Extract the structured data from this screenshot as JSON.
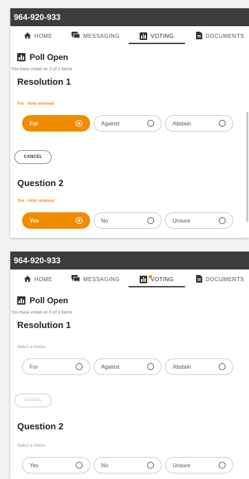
{
  "panels": [
    {
      "title": "964-920-933",
      "tabs": {
        "home": "HOME",
        "messaging": "MESSAGING",
        "voting": "VOTING",
        "documents": "DOCUMENTS"
      },
      "poll_header": "Poll Open",
      "voted_text": "You have voted on 2 of 2 items",
      "resolution": {
        "title": "Resolution 1",
        "status": "For - Vote received",
        "options": [
          "For",
          "Against",
          "Abstain"
        ],
        "selected": "For"
      },
      "cancel_label": "CANCEL",
      "question": {
        "title": "Question 2",
        "status": "Yes - Vote received",
        "options": [
          "Yes",
          "No",
          "Unsure"
        ],
        "selected": "Yes"
      }
    },
    {
      "title": "964-920-933",
      "tabs": {
        "home": "HOME",
        "messaging": "MESSAGING",
        "voting": "VOTING",
        "documents": "DOCUMENTS"
      },
      "poll_header": "Poll Open",
      "voted_text": "You have voted on 0 of 2 items",
      "resolution": {
        "title": "Resolution 1",
        "status": "Select a choice.",
        "options": [
          "For",
          "Against",
          "Abstain"
        ],
        "selected": ""
      },
      "cancel_label": "CANCEL",
      "question": {
        "title": "Question 2",
        "status": "Select a choice.",
        "options": [
          "Yes",
          "No",
          "Unsure"
        ],
        "selected": ""
      }
    }
  ],
  "colors": {
    "accent": "#f08c00",
    "titlebar": "#3c3c3c",
    "border": "#cccccc"
  }
}
